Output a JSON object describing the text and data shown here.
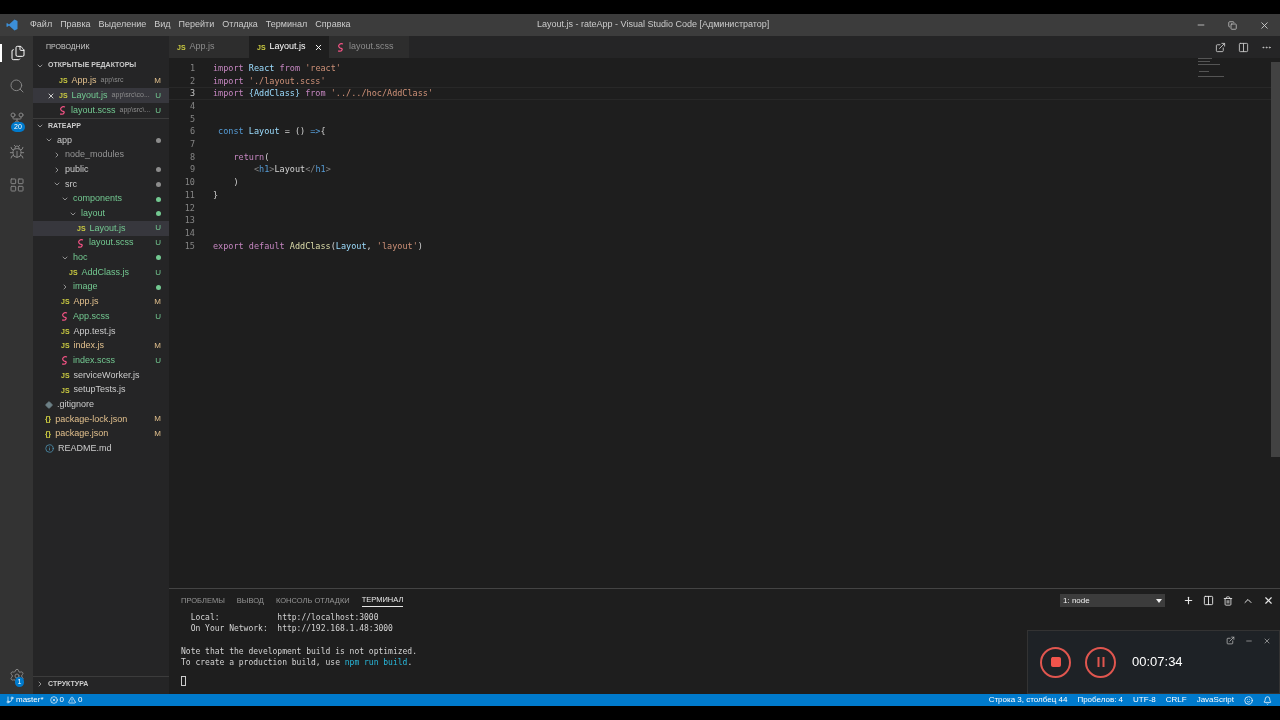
{
  "title_bar": {
    "menu": [
      "Файл",
      "Правка",
      "Выделение",
      "Вид",
      "Перейти",
      "Отладка",
      "Терминал",
      "Справка"
    ],
    "title": "Layout.js - rateApp - Visual Studio Code [Администратор]"
  },
  "activity_bar": {
    "items": [
      {
        "kind": "explorer",
        "selected": true
      },
      {
        "kind": "search",
        "selected": false
      },
      {
        "kind": "scm",
        "selected": false,
        "badge": "20"
      },
      {
        "kind": "debug",
        "selected": false
      },
      {
        "kind": "extensions",
        "selected": false
      }
    ],
    "settings_badge": "1"
  },
  "explorer": {
    "title": "ПРОВОДНИК",
    "open_editors": {
      "title": "ОТКРЫТЫЕ РЕДАКТОРЫ",
      "expanded": true,
      "items": [
        {
          "name": "App.js",
          "path": "app\\src",
          "kind": "js",
          "icon": "JS",
          "modified": true,
          "untracked": false,
          "status": "M",
          "selected": false,
          "closable": false
        },
        {
          "name": "Layout.js",
          "path": "app\\src\\co...",
          "kind": "js",
          "icon": "JS",
          "modified": false,
          "untracked": true,
          "status": "U",
          "selected": true,
          "closable": true
        },
        {
          "name": "layout.scss",
          "path": "app\\src\\...",
          "kind": "scss",
          "modified": false,
          "untracked": true,
          "status": "U",
          "selected": false,
          "closable": false
        }
      ]
    },
    "project": {
      "title": "RATEAPP",
      "expanded": true,
      "children": [
        {
          "name": "app",
          "kind": "folder",
          "expanded": true,
          "changed": true,
          "modified": false,
          "untracked": false,
          "ignored": false,
          "selected": false,
          "children": [
            {
              "name": "node_modules",
              "kind": "folder",
              "expanded": false,
              "changed": false,
              "modified": false,
              "untracked": false,
              "ignored": true,
              "selected": false
            },
            {
              "name": "public",
              "kind": "folder",
              "expanded": false,
              "changed": true,
              "modified": false,
              "untracked": false,
              "ignored": false,
              "selected": false
            },
            {
              "name": "src",
              "kind": "folder",
              "expanded": true,
              "changed": true,
              "modified": false,
              "untracked": false,
              "ignored": false,
              "selected": false,
              "children": [
                {
                  "name": "components",
                  "kind": "folder",
                  "expanded": true,
                  "changed": true,
                  "modified": false,
                  "untracked": true,
                  "ignored": false,
                  "selected": false,
                  "children": [
                    {
                      "name": "layout",
                      "kind": "folder",
                      "expanded": true,
                      "changed": true,
                      "modified": false,
                      "untracked": true,
                      "ignored": false,
                      "selected": false,
                      "children": [
                        {
                          "name": "Layout.js",
                          "kind": "js",
                          "icon": "JS",
                          "modified": false,
                          "untracked": true,
                          "ignored": false,
                          "status": "U",
                          "selected": true
                        },
                        {
                          "name": "layout.scss",
                          "kind": "scss",
                          "modified": false,
                          "untracked": true,
                          "ignored": false,
                          "status": "U",
                          "selected": false
                        }
                      ]
                    }
                  ]
                },
                {
                  "name": "hoc",
                  "kind": "folder",
                  "expanded": true,
                  "changed": true,
                  "modified": false,
                  "untracked": true,
                  "ignored": false,
                  "selected": false,
                  "children": [
                    {
                      "name": "AddClass.js",
                      "kind": "js",
                      "icon": "JS",
                      "modified": false,
                      "untracked": true,
                      "ignored": false,
                      "status": "U",
                      "selected": false
                    }
                  ]
                },
                {
                  "name": "image",
                  "kind": "folder",
                  "expanded": false,
                  "changed": true,
                  "modified": false,
                  "untracked": true,
                  "ignored": false,
                  "selected": false
                },
                {
                  "name": "App.js",
                  "kind": "js",
                  "icon": "JS",
                  "modified": true,
                  "untracked": false,
                  "ignored": false,
                  "status": "M",
                  "selected": false
                },
                {
                  "name": "App.scss",
                  "kind": "scss",
                  "modified": false,
                  "untracked": true,
                  "ignored": false,
                  "status": "U",
                  "selected": false
                },
                {
                  "name": "App.test.js",
                  "kind": "js",
                  "icon": "JS",
                  "modified": false,
                  "untracked": false,
                  "ignored": false,
                  "selected": false
                },
                {
                  "name": "index.js",
                  "kind": "js",
                  "icon": "JS",
                  "modified": true,
                  "untracked": false,
                  "ignored": false,
                  "status": "M",
                  "selected": false
                },
                {
                  "name": "index.scss",
                  "kind": "scss",
                  "modified": false,
                  "untracked": true,
                  "ignored": false,
                  "status": "U",
                  "selected": false
                },
                {
                  "name": "serviceWorker.js",
                  "kind": "js",
                  "icon": "JS",
                  "modified": false,
                  "untracked": false,
                  "ignored": false,
                  "selected": false
                },
                {
                  "name": "setupTests.js",
                  "kind": "js",
                  "icon": "JS",
                  "modified": false,
                  "untracked": false,
                  "ignored": false,
                  "selected": false
                }
              ]
            }
          ]
        },
        {
          "name": ".gitignore",
          "kind": "git",
          "modified": false,
          "untracked": false,
          "ignored": false,
          "selected": false
        },
        {
          "name": "package-lock.json",
          "kind": "json",
          "icon": "{}",
          "modified": true,
          "untracked": false,
          "ignored": false,
          "status": "M",
          "selected": false
        },
        {
          "name": "package.json",
          "kind": "json",
          "icon": "{}",
          "modified": true,
          "untracked": false,
          "ignored": false,
          "status": "M",
          "selected": false
        },
        {
          "name": "README.md",
          "kind": "info",
          "modified": false,
          "untracked": false,
          "ignored": false,
          "selected": false
        }
      ]
    },
    "outline": {
      "title": "СТРУКТУРА",
      "expanded": false
    }
  },
  "tabs": [
    {
      "name": "App.js",
      "kind": "js",
      "icon": "JS",
      "selected": false
    },
    {
      "name": "Layout.js",
      "kind": "js",
      "icon": "JS",
      "selected": true
    },
    {
      "name": "layout.scss",
      "kind": "scss",
      "selected": false
    }
  ],
  "editor": {
    "lines": [
      {
        "number": "1",
        "current": false,
        "tokens": [
          {
            "text": "import ",
            "kind": "keyword"
          },
          {
            "text": "React ",
            "kind": "variable"
          },
          {
            "text": "from ",
            "kind": "keyword"
          },
          {
            "text": "'react'",
            "kind": "string"
          }
        ]
      },
      {
        "number": "2",
        "current": false,
        "tokens": [
          {
            "text": "import ",
            "kind": "keyword"
          },
          {
            "text": "'./layout.scss'",
            "kind": "string"
          }
        ]
      },
      {
        "number": "3",
        "current": true,
        "tokens": [
          {
            "text": "import ",
            "kind": "keyword"
          },
          {
            "text": "{AddClass} ",
            "kind": "variable"
          },
          {
            "text": "from ",
            "kind": "keyword"
          },
          {
            "text": "'../../hoc/AddClass'",
            "kind": "string"
          }
        ]
      },
      {
        "number": "4",
        "current": false
      },
      {
        "number": "5",
        "current": false
      },
      {
        "number": "6",
        "current": false,
        "tokens": [
          {
            "text": " const ",
            "kind": "storage"
          },
          {
            "text": "Layout ",
            "kind": "variable"
          },
          {
            "text": "= () ",
            "kind": "plain"
          },
          {
            "text": "=>",
            "kind": "storage"
          },
          {
            "text": "{",
            "kind": "plain"
          }
        ]
      },
      {
        "number": "7",
        "current": false
      },
      {
        "number": "8",
        "current": false,
        "tokens": [
          {
            "text": "    return",
            "kind": "keyword"
          },
          {
            "text": "(",
            "kind": "plain"
          }
        ]
      },
      {
        "number": "9",
        "current": false,
        "tokens": [
          {
            "text": "        <",
            "kind": "bracket"
          },
          {
            "text": "h1",
            "kind": "tag"
          },
          {
            "text": ">",
            "kind": "bracket"
          },
          {
            "text": "Layout",
            "kind": "plain"
          },
          {
            "text": "</",
            "kind": "bracket"
          },
          {
            "text": "h1",
            "kind": "tag"
          },
          {
            "text": ">",
            "kind": "bracket"
          }
        ]
      },
      {
        "number": "10",
        "current": false,
        "tokens": [
          {
            "text": "    )",
            "kind": "plain"
          }
        ]
      },
      {
        "number": "11",
        "current": false,
        "tokens": [
          {
            "text": "}",
            "kind": "plain"
          }
        ]
      },
      {
        "number": "12",
        "current": false
      },
      {
        "number": "13",
        "current": false
      },
      {
        "number": "14",
        "current": false
      },
      {
        "number": "15",
        "current": false,
        "tokens": [
          {
            "text": "export ",
            "kind": "keyword"
          },
          {
            "text": "default ",
            "kind": "keyword"
          },
          {
            "text": "AddClass",
            "kind": "function"
          },
          {
            "text": "(",
            "kind": "plain"
          },
          {
            "text": "Layout",
            "kind": "variable"
          },
          {
            "text": ", ",
            "kind": "plain"
          },
          {
            "text": "'layout'",
            "kind": "string"
          },
          {
            "text": ")",
            "kind": "plain"
          }
        ]
      }
    ]
  },
  "panel": {
    "tabs": [
      {
        "label": "ПРОБЛЕМЫ",
        "selected": false
      },
      {
        "label": "ВЫВОД",
        "selected": false
      },
      {
        "label": "КОНСОЛЬ ОТЛАДКИ",
        "selected": false
      },
      {
        "label": "ТЕРМИНАЛ",
        "selected": true
      }
    ],
    "terminal_select": "1: node",
    "terminal_blocks": [
      [
        [
          {
            "text": "  Local:            http://localhost:3000",
            "kind": "plain"
          }
        ],
        [
          {
            "text": "  On Your Network:  http://192.168.1.48:3000",
            "kind": "plain"
          }
        ]
      ],
      [
        [
          {
            "text": "Note that the development build is not optimized.",
            "kind": "plain"
          }
        ],
        [
          {
            "text": "To create a production build, use ",
            "kind": "plain"
          },
          {
            "text": "npm run build",
            "kind": "command"
          },
          {
            "text": ".",
            "kind": "plain"
          }
        ]
      ]
    ]
  },
  "status_bar": {
    "branch": "master*",
    "errors": "0",
    "warnings": "0",
    "items": [
      "Строка 3, столбец 44",
      "Пробелов: 4",
      "UTF-8",
      "CRLF",
      "JavaScript"
    ]
  },
  "recorder": {
    "time": "00:07:34"
  }
}
